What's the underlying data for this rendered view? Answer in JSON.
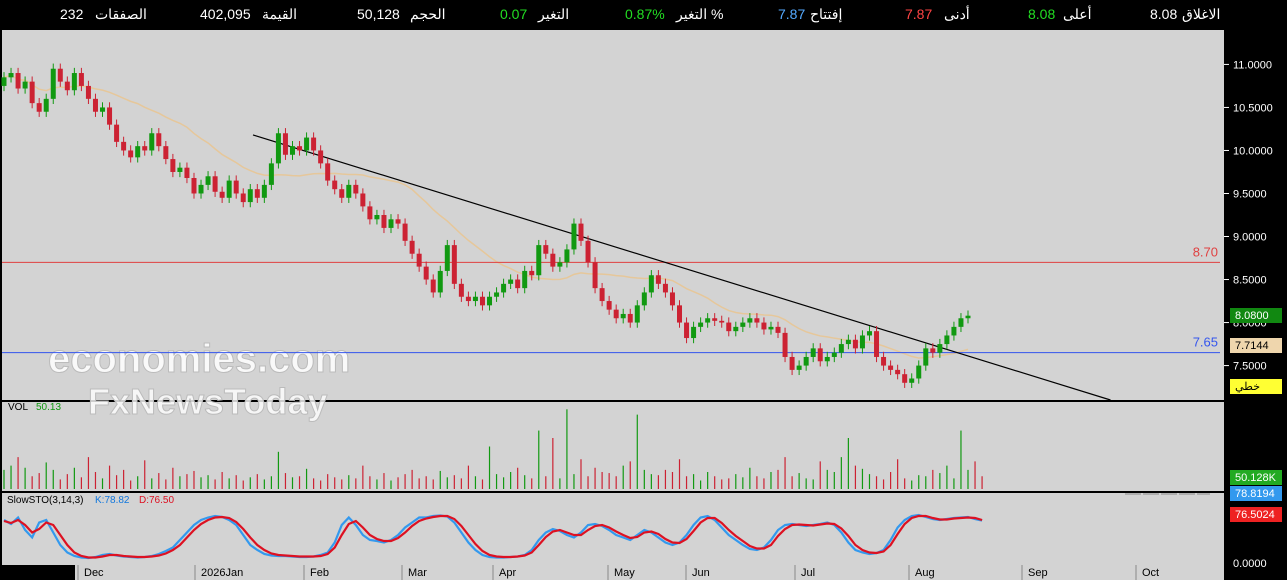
{
  "stats": {
    "close_label": "الاغلاق",
    "close_value": "8.08",
    "high_label": "أعلى",
    "high_value": "8.08",
    "low_label": "أدنى",
    "low_value": "7.87",
    "open_label": "إفتتاح",
    "open_value": "7.87",
    "change_pct_label": "التغير %",
    "change_pct_value": "0.87%",
    "change_label": "التغير",
    "change_value": "0.07",
    "volume_label": "الحجم",
    "volume_value": "50,128",
    "value_label": "القيمة",
    "value_value": "402,095",
    "deals_label": "الصفقات",
    "deals_value": "232"
  },
  "watermark": {
    "line1": "economies.com",
    "line2": "FxNewsToday"
  },
  "colors": {
    "up": "#119911",
    "down": "#cc2233",
    "ma": "#e6c79a",
    "resistance": "#e04040",
    "support": "#3355ee",
    "k_line": "#3399ee",
    "d_line": "#dd1122",
    "panel_bg": "#d3d3d3",
    "close_badge": "#118811"
  },
  "chart_data": {
    "type": "candlestick",
    "x_ticks": [
      "Dec",
      "2026Jan",
      "Feb",
      "Mar",
      "Apr",
      "May",
      "Jun",
      "Jul",
      "Aug",
      "Sep",
      "Oct"
    ],
    "y_ticks": [
      "11.0000",
      "10.5000",
      "10.0000",
      "9.5000",
      "9.0000",
      "8.5000",
      "8.0000",
      "7.5000"
    ],
    "ylim": [
      7.1,
      11.4
    ],
    "resistance_level": 8.7,
    "resistance_label": "8.70",
    "support_level": 7.65,
    "support_label": "7.65",
    "last_close_label": "8.0800",
    "ma_value_label": "7.7144",
    "draw_tool_label": "خطي",
    "trendline": {
      "start": [
        "2026-01-20",
        10.18
      ],
      "end": [
        "2026-09-22",
        7.1
      ]
    },
    "closes": [
      10.85,
      10.9,
      10.72,
      10.8,
      10.55,
      10.45,
      10.6,
      10.95,
      10.8,
      10.7,
      10.9,
      10.75,
      10.6,
      10.45,
      10.5,
      10.3,
      10.1,
      10.0,
      9.92,
      10.05,
      10.0,
      10.2,
      10.05,
      9.9,
      9.75,
      9.8,
      9.68,
      9.5,
      9.6,
      9.7,
      9.52,
      9.45,
      9.65,
      9.5,
      9.4,
      9.55,
      9.45,
      9.6,
      9.85,
      10.2,
      9.95,
      10.05,
      10.0,
      10.15,
      10.0,
      9.85,
      9.65,
      9.55,
      9.45,
      9.6,
      9.5,
      9.35,
      9.2,
      9.25,
      9.1,
      9.2,
      9.15,
      8.95,
      8.8,
      8.65,
      8.5,
      8.35,
      8.6,
      8.9,
      8.45,
      8.3,
      8.25,
      8.3,
      8.2,
      8.3,
      8.35,
      8.45,
      8.5,
      8.4,
      8.6,
      8.55,
      8.9,
      8.8,
      8.65,
      8.7,
      8.85,
      9.15,
      8.95,
      8.7,
      8.4,
      8.25,
      8.15,
      8.05,
      8.1,
      8.0,
      8.2,
      8.35,
      8.55,
      8.45,
      8.35,
      8.2,
      8.0,
      7.82,
      7.95,
      8.0,
      8.05,
      8.02,
      8.0,
      7.9,
      7.95,
      8.0,
      8.05,
      8.0,
      7.92,
      7.95,
      7.88,
      7.6,
      7.45,
      7.5,
      7.6,
      7.7,
      7.55,
      7.6,
      7.65,
      7.75,
      7.8,
      7.7,
      7.85,
      7.9,
      7.6,
      7.5,
      7.45,
      7.4,
      7.3,
      7.35,
      7.5,
      7.7,
      7.65,
      7.75,
      7.85,
      7.95,
      8.05,
      8.08
    ],
    "volume": {
      "label": "VOL",
      "value_label": "50.13",
      "last_label": "50.128K",
      "values": [
        18,
        22,
        30,
        20,
        12,
        15,
        25,
        18,
        9,
        14,
        20,
        11,
        30,
        16,
        10,
        22,
        13,
        18,
        8,
        12,
        27,
        10,
        15,
        9,
        20,
        12,
        14,
        17,
        11,
        13,
        9,
        16,
        10,
        13,
        8,
        11,
        14,
        9,
        12,
        35,
        15,
        11,
        12,
        19,
        10,
        8,
        14,
        11,
        9,
        13,
        10,
        22,
        12,
        9,
        15,
        8,
        11,
        14,
        18,
        10,
        12,
        9,
        17,
        11,
        13,
        10,
        22,
        12,
        9,
        40,
        14,
        11,
        16,
        20,
        13,
        10,
        55,
        12,
        48,
        10,
        75,
        14,
        28,
        12,
        20,
        16,
        15,
        12,
        22,
        26,
        70,
        18,
        14,
        13,
        18,
        16,
        28,
        12,
        14,
        8,
        16,
        12,
        9,
        10,
        14,
        11,
        20,
        12,
        10,
        16,
        18,
        30,
        12,
        15,
        10,
        9,
        26,
        18,
        16,
        30,
        48,
        22,
        19,
        14,
        12,
        9,
        16,
        28,
        10,
        8,
        13,
        12,
        18,
        15,
        22,
        10,
        55,
        18,
        26,
        12
      ]
    },
    "stochastic": {
      "label": "SlowSTO(3,14,3)",
      "k_label": "K:78.82",
      "d_label": "D:76.50",
      "k_value": 78.82,
      "d_value": 76.5,
      "k_badge": "78.8194",
      "d_badge": "76.5024",
      "zero_label": "0.0000",
      "k": [
        80,
        72,
        85,
        60,
        45,
        75,
        80,
        55,
        30,
        15,
        8,
        5,
        4,
        6,
        10,
        12,
        9,
        7,
        6,
        5,
        6,
        8,
        12,
        18,
        25,
        40,
        55,
        70,
        80,
        85,
        88,
        86,
        80,
        70,
        50,
        30,
        20,
        12,
        9,
        8,
        8,
        7,
        6,
        6,
        7,
        10,
        15,
        35,
        70,
        85,
        70,
        50,
        40,
        38,
        35,
        40,
        50,
        65,
        75,
        85,
        85,
        88,
        89,
        87,
        75,
        55,
        35,
        20,
        10,
        6,
        5,
        5,
        6,
        7,
        10,
        20,
        40,
        55,
        62,
        58,
        50,
        45,
        55,
        70,
        72,
        68,
        60,
        50,
        45,
        40,
        50,
        60,
        55,
        45,
        35,
        30,
        35,
        50,
        70,
        85,
        88,
        80,
        65,
        50,
        40,
        30,
        22,
        20,
        25,
        40,
        60,
        70,
        72,
        70,
        68,
        70,
        72,
        75,
        70,
        55,
        35,
        20,
        15,
        12,
        14,
        20,
        40,
        65,
        80,
        88,
        90,
        86,
        82,
        80,
        82,
        84,
        85,
        86,
        82,
        79
      ],
      "d": [
        78,
        74,
        80,
        70,
        55,
        62,
        75,
        70,
        50,
        30,
        15,
        8,
        5,
        5,
        7,
        10,
        10,
        8,
        7,
        6,
        6,
        7,
        9,
        13,
        20,
        30,
        45,
        60,
        72,
        80,
        85,
        86,
        84,
        76,
        62,
        45,
        30,
        20,
        13,
        10,
        9,
        8,
        7,
        7,
        7,
        8,
        12,
        25,
        50,
        72,
        78,
        65,
        50,
        42,
        38,
        38,
        44,
        55,
        68,
        78,
        83,
        86,
        88,
        88,
        82,
        68,
        50,
        32,
        18,
        10,
        7,
        6,
        6,
        7,
        9,
        15,
        30,
        46,
        57,
        60,
        55,
        50,
        50,
        60,
        68,
        70,
        65,
        57,
        50,
        44,
        46,
        55,
        57,
        52,
        42,
        35,
        34,
        42,
        58,
        75,
        84,
        84,
        74,
        60,
        48,
        38,
        28,
        23,
        23,
        30,
        48,
        62,
        70,
        71,
        70,
        69,
        71,
        73,
        72,
        63,
        48,
        30,
        20,
        15,
        14,
        17,
        30,
        52,
        72,
        84,
        88,
        88,
        84,
        81,
        81,
        83,
        84,
        85,
        84,
        80
      ]
    }
  }
}
